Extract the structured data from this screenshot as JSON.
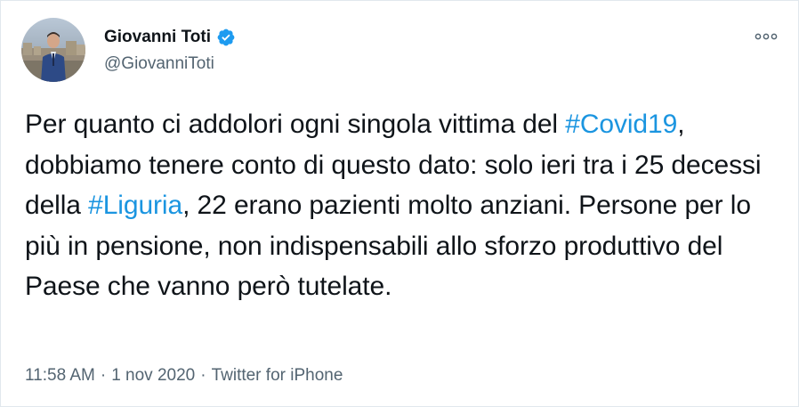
{
  "author": {
    "name": "Giovanni Toti",
    "handle": "@GiovanniToti",
    "verified": true
  },
  "tweet": {
    "segments": [
      {
        "type": "text",
        "value": "Per quanto ci addolori ogni singola vittima del "
      },
      {
        "type": "hashtag",
        "value": "#Covid19"
      },
      {
        "type": "text",
        "value": ", dobbiamo tenere conto di questo dato: solo ieri tra i 25 decessi della "
      },
      {
        "type": "hashtag",
        "value": "#Liguria"
      },
      {
        "type": "text",
        "value": ", 22 erano pazienti molto anziani. Persone per lo più in pensione, non indispensabili allo sforzo produttivo del Paese che vanno però tutelate."
      }
    ]
  },
  "meta": {
    "time": "11:58 AM",
    "separator": "·",
    "date": "1 nov 2020",
    "source": "Twitter for iPhone"
  },
  "colors": {
    "link": "#1b95e0",
    "verified_badge": "#1d9bf0",
    "secondary_text": "#536471"
  },
  "icons": {
    "more": "more-horizontal-icon",
    "verified": "verified-badge-icon"
  }
}
